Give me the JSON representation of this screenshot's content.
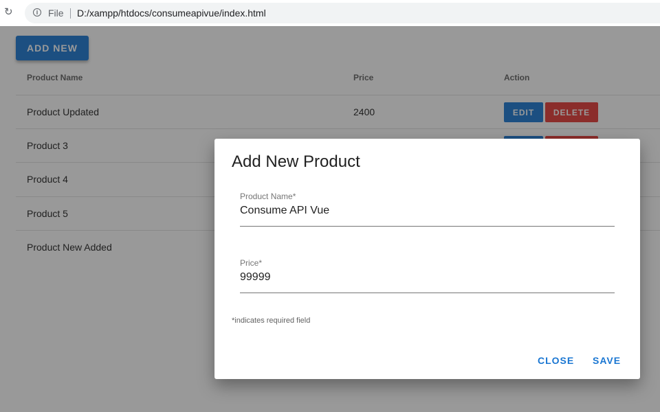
{
  "browser": {
    "scheme_label": "File",
    "url": "D:/xampp/htdocs/consumeapivue/index.html",
    "reload_icon": "reload-icon",
    "info_icon": "info-icon"
  },
  "page": {
    "add_new_label": "ADD NEW",
    "table": {
      "headers": [
        "Product Name",
        "Price",
        "Action"
      ],
      "rows": [
        {
          "name": "Product Updated",
          "price": "2400",
          "edit_label": "EDIT",
          "delete_label": "DELETE"
        },
        {
          "name": "Product 3",
          "price": "",
          "edit_label": "",
          "delete_label": ""
        },
        {
          "name": "Product 4",
          "price": "",
          "edit_label": "",
          "delete_label": ""
        },
        {
          "name": "Product 5",
          "price": "",
          "edit_label": "",
          "delete_label": ""
        },
        {
          "name": "Product New Added",
          "price": "",
          "edit_label": "",
          "delete_label": ""
        }
      ]
    }
  },
  "dialog": {
    "title": "Add New Product",
    "fields": [
      {
        "label": "Product Name*",
        "value": "Consume API Vue"
      },
      {
        "label": "Price*",
        "value": "99999"
      }
    ],
    "hint": "*indicates required field",
    "close_label": "CLOSE",
    "save_label": "SAVE"
  },
  "colors": {
    "primary": "#1976d2",
    "danger": "#e53935",
    "overlay": "rgba(33,33,33,0.46)"
  }
}
